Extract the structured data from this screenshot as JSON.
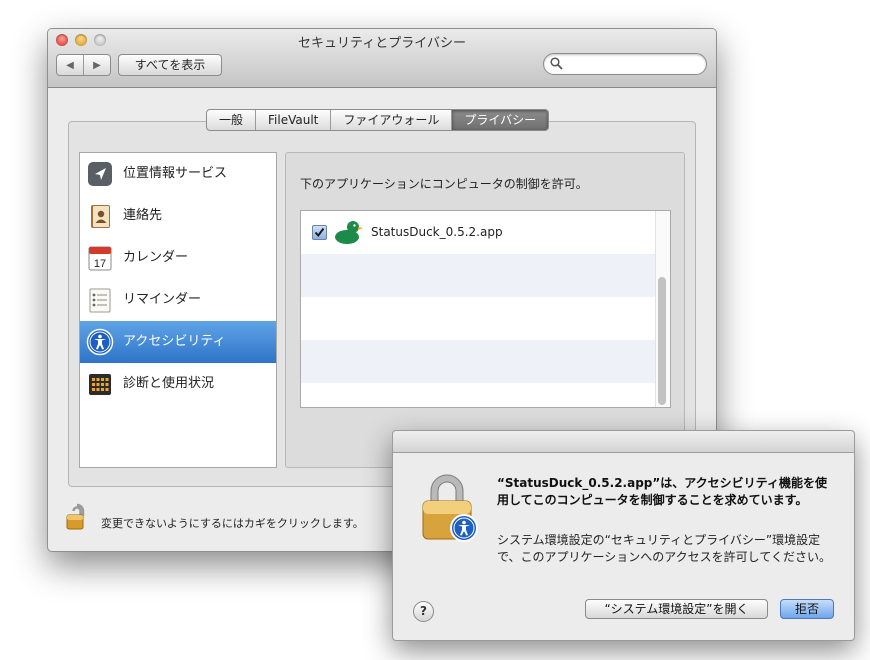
{
  "window": {
    "title": "セキュリティとプライバシー",
    "back_glyph": "◀",
    "forward_glyph": "▶",
    "show_all": "すべてを表示",
    "search_placeholder": ""
  },
  "tabs": [
    {
      "label": "一般",
      "active": false
    },
    {
      "label": "FileVault",
      "active": false
    },
    {
      "label": "ファイアウォール",
      "active": false
    },
    {
      "label": "プライバシー",
      "active": true
    }
  ],
  "sidebar": {
    "items": [
      {
        "label": "位置情報サービス",
        "icon": "location-services-icon",
        "selected": false
      },
      {
        "label": "連絡先",
        "icon": "contacts-icon",
        "selected": false
      },
      {
        "label": "カレンダー",
        "icon": "calendar-icon",
        "selected": false,
        "icon_text": "17"
      },
      {
        "label": "リマインダー",
        "icon": "reminders-icon",
        "selected": false
      },
      {
        "label": "アクセシビリティ",
        "icon": "accessibility-icon",
        "selected": true
      },
      {
        "label": "診断と使用状況",
        "icon": "diagnostics-icon",
        "selected": false
      }
    ]
  },
  "content": {
    "description": "下のアプリケーションにコンピュータの制御を許可。",
    "apps": [
      {
        "name": "StatusDuck_0.5.2.app",
        "checked": true,
        "icon": "duck-icon"
      }
    ]
  },
  "footer": {
    "lock_text": "変更できないようにするにはカギをクリックします。"
  },
  "dialog": {
    "title": "“StatusDuck_0.5.2.app”は、アクセシビリティ機能を使用してこのコンピュータを制御することを求めています。",
    "body": "システム環境設定の“セキュリティとプライバシー”環境設定で、このアプリケーションへのアクセスを許可してください。",
    "help_glyph": "?",
    "open_button": "“システム環境設定”を開く",
    "deny_button": "拒否"
  },
  "colors": {
    "selection": "#2e74c9",
    "deny_button": "#6ea5ea",
    "list_alt_row": "#eef2f8"
  }
}
